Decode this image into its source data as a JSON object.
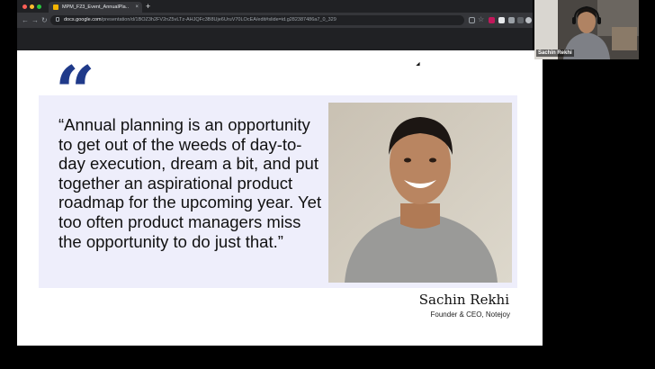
{
  "browser": {
    "tab_title": "MPM_F23_Event_AnnualPla…",
    "tab_close": "×",
    "new_tab": "+",
    "url_host": "docs.google.com",
    "url_path": "/presentation/d/1BOZ3h2FV2nZ5vLTz-AHJQFc3B8Uje6UruV70LOcEA/edit#slide=id.g282387486a7_0_329",
    "colors": {
      "frame": "#202124",
      "toolbar": "#35363a"
    }
  },
  "slide": {
    "quote_mark": "“",
    "quote": "“Annual planning is an opportunity to get out of the weeds of day-to-day execution, dream a bit, and put together an aspirational product roadmap for the upcoming year. Yet too often product managers miss the opportunity to do just that.”",
    "author_name": "Sachin Rekhi",
    "author_title": "Founder & CEO, Notejoy",
    "colors": {
      "quote_mark": "#1f3a8a",
      "panel": "#eeeefb"
    }
  },
  "video": {
    "participant_name": "Sachin Rekhi"
  }
}
